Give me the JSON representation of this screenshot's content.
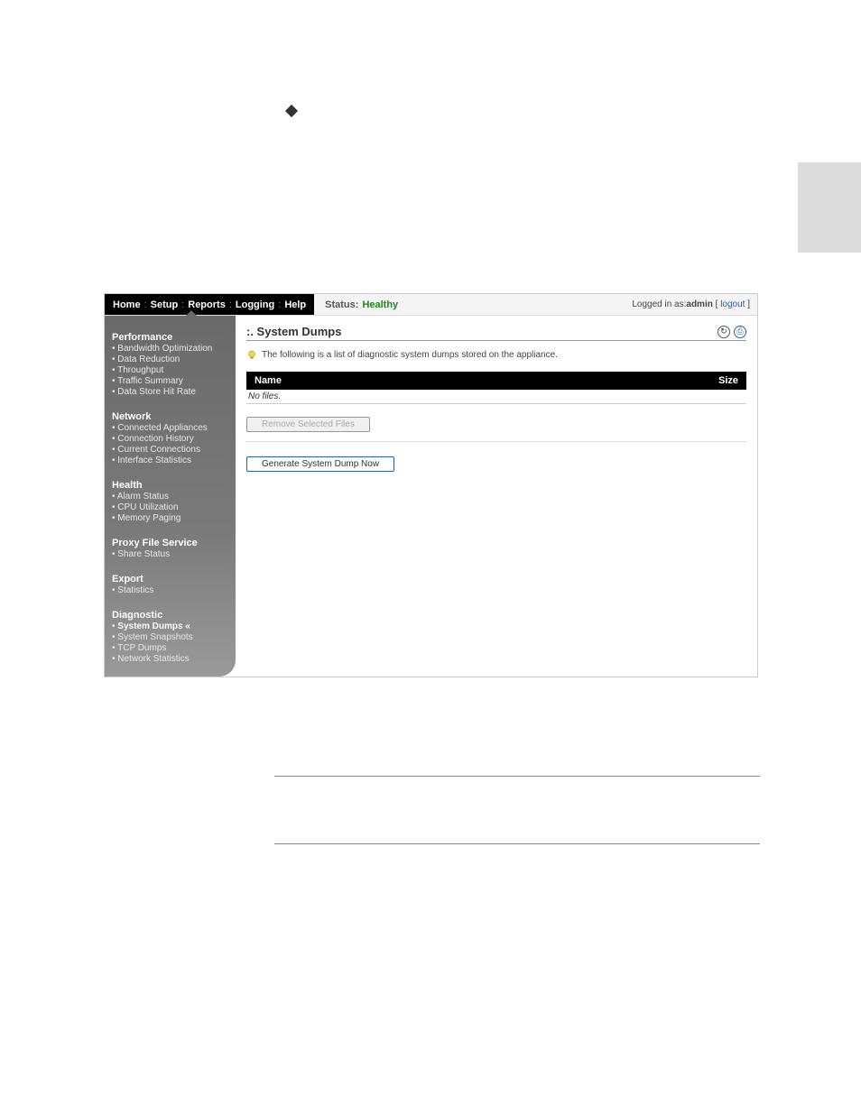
{
  "nav": {
    "home": "Home",
    "setup": "Setup",
    "reports": "Reports",
    "logging": "Logging",
    "help": "Help"
  },
  "status": {
    "label": "Status:",
    "value": "Healthy"
  },
  "login": {
    "prefix": "Logged in as: ",
    "user": "admin",
    "logout": "logout"
  },
  "sidebar": {
    "performance": {
      "title": "Performance",
      "bandwidth": "Bandwidth Optimization",
      "data_reduction": "Data Reduction",
      "throughput": "Throughput",
      "traffic_summary": "Traffic Summary",
      "data_store_hit": "Data Store Hit Rate"
    },
    "network": {
      "title": "Network",
      "connected": "Connected Appliances",
      "conn_history": "Connection History",
      "current_conn": "Current Connections",
      "iface_stats": "Interface Statistics"
    },
    "health": {
      "title": "Health",
      "alarm": "Alarm Status",
      "cpu": "CPU Utilization",
      "memory": "Memory Paging"
    },
    "pfs": {
      "title": "Proxy File Service",
      "share": "Share Status"
    },
    "export": {
      "title": "Export",
      "statistics": "Statistics"
    },
    "diagnostic": {
      "title": "Diagnostic",
      "system_dumps": "System Dumps",
      "system_snapshots": "System Snapshots",
      "tcp_dumps": "TCP Dumps",
      "network_stats": "Network Statistics"
    }
  },
  "main": {
    "title": ":. System Dumps",
    "info": "The following is a list of diagnostic system dumps stored on the appliance.",
    "table": {
      "col_name": "Name",
      "col_size": "Size",
      "no_files": "No files."
    },
    "remove_btn": "Remove Selected Files",
    "generate_btn": "Generate System Dump Now"
  }
}
